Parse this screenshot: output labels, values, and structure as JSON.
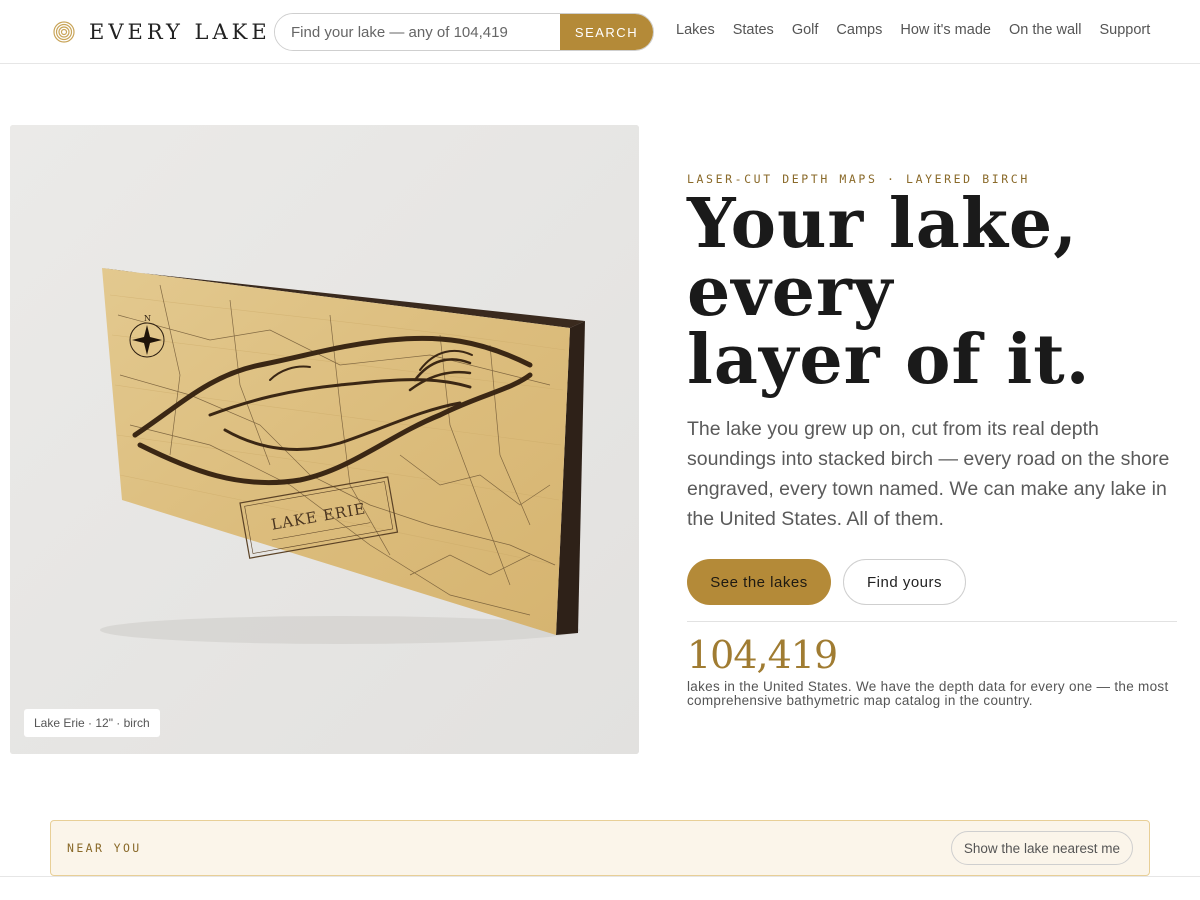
{
  "brand": {
    "name": "EVERY LAKE",
    "icon": "concentric-rings-icon",
    "accent": "#b48a38"
  },
  "search": {
    "placeholder": "Find your lake — any of 104,419",
    "button_label": "SEARCH"
  },
  "nav": {
    "items": [
      {
        "label": "Lakes"
      },
      {
        "label": "States"
      },
      {
        "label": "Golf"
      },
      {
        "label": "Camps"
      },
      {
        "label": "How it's made"
      },
      {
        "label": "On the wall"
      },
      {
        "label": "Support"
      }
    ]
  },
  "hero": {
    "image": {
      "subject": "Lake Erie laser-cut birch depth map",
      "engraved_title": "LAKE ERIE",
      "caption": "Lake Erie · 12\" · birch"
    },
    "eyebrow": "LASER-CUT DEPTH MAPS · LAYERED BIRCH",
    "headline": {
      "line1": "Your lake,",
      "line2": "every",
      "line3": "layer of it."
    },
    "body": "The lake you grew up on, cut from its real depth soundings into stacked birch — every road on the shore engraved, every town named. We can make any lake in the United States. All of them.",
    "primary_cta": "See the lakes",
    "secondary_cta": "Find yours",
    "stat": {
      "number": "104,419",
      "text": "lakes in the United States. We have the depth data for every one — the most comprehensive bathymetric map catalog in the country."
    }
  },
  "near_you": {
    "label": "NEAR YOU",
    "button_label": "Show the lake nearest me"
  }
}
